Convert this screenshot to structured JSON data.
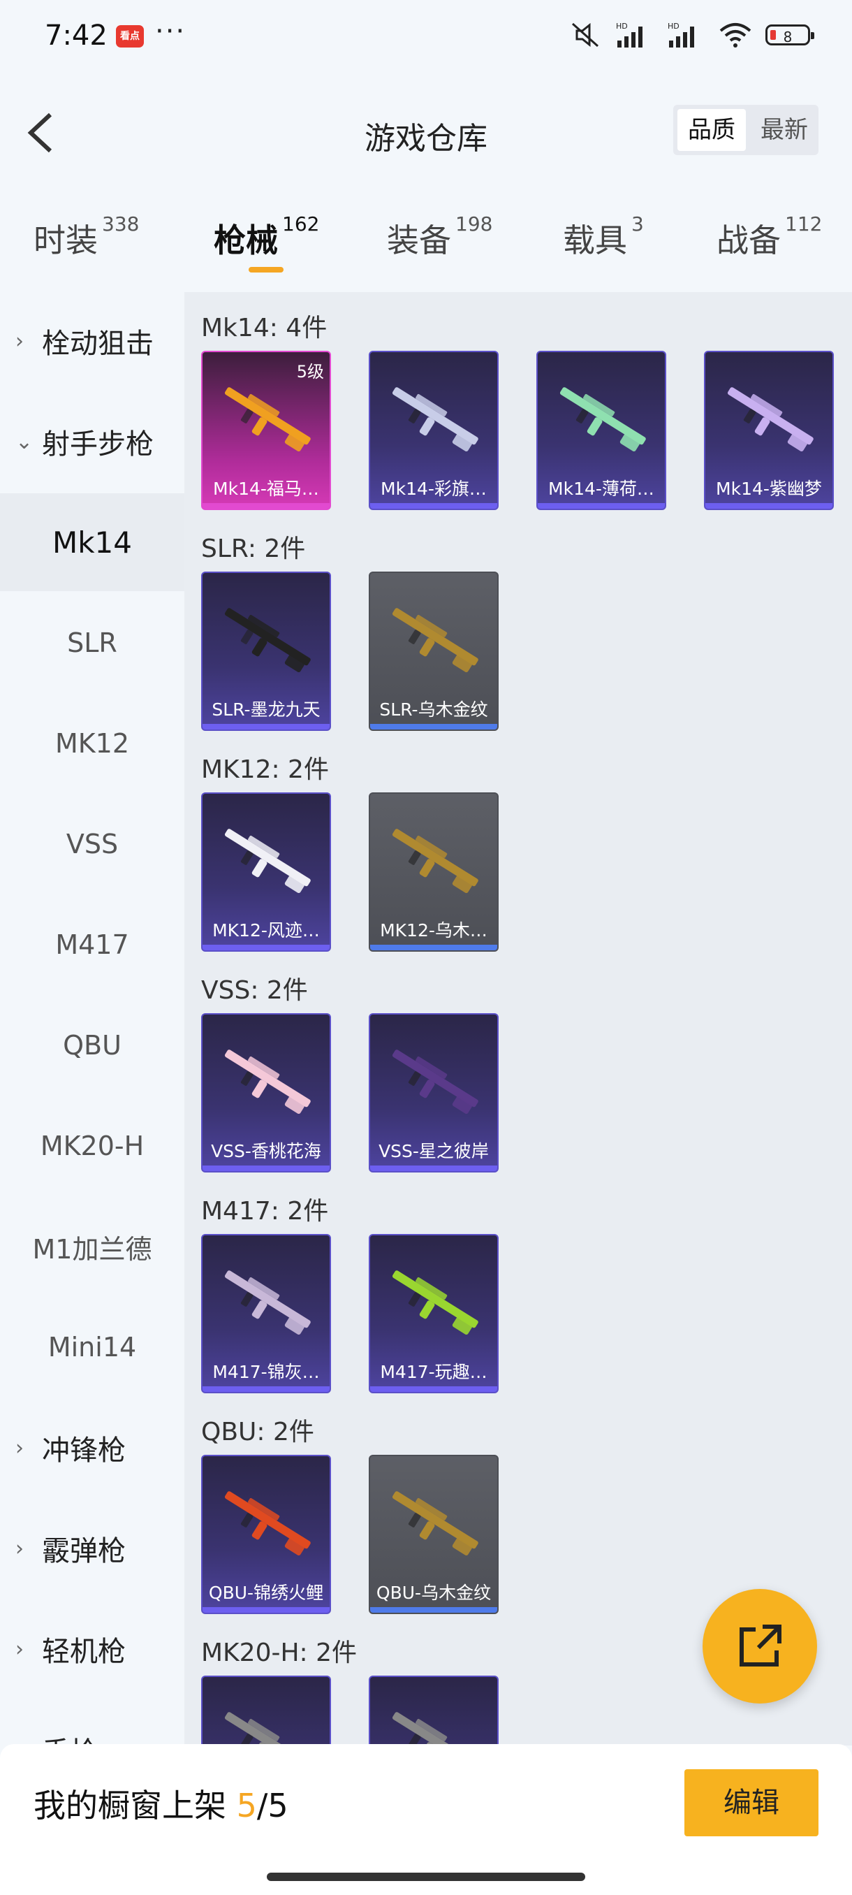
{
  "status": {
    "time": "7:42",
    "app_badge": "看点",
    "dots": "···",
    "signal1": "HD",
    "signal2": "HD",
    "battery": "8"
  },
  "header": {
    "title": "游戏仓库",
    "sort_quality": "品质",
    "sort_latest": "最新"
  },
  "tabs": [
    {
      "label": "时装",
      "count": "338"
    },
    {
      "label": "枪械",
      "count": "162"
    },
    {
      "label": "装备",
      "count": "198"
    },
    {
      "label": "载具",
      "count": "3"
    },
    {
      "label": "战备",
      "count": "112"
    }
  ],
  "sidebar": [
    {
      "label": "栓动狙击",
      "type": "category",
      "chevron": "›"
    },
    {
      "label": "射手步枪",
      "type": "category",
      "chevron": "⌄"
    },
    {
      "label": "Mk14",
      "type": "selected"
    },
    {
      "label": "SLR"
    },
    {
      "label": "MK12"
    },
    {
      "label": "VSS"
    },
    {
      "label": "M417"
    },
    {
      "label": "QBU"
    },
    {
      "label": "MK20-H"
    },
    {
      "label": "M1加兰德"
    },
    {
      "label": "Mini14"
    },
    {
      "label": "冲锋枪",
      "type": "category",
      "chevron": "›"
    },
    {
      "label": "霰弹枪",
      "type": "category",
      "chevron": "›"
    },
    {
      "label": "轻机枪",
      "type": "category",
      "chevron": "›"
    },
    {
      "label": "手枪",
      "type": "category",
      "chevron": "›"
    }
  ],
  "groups": [
    {
      "title": "Mk14: 4件",
      "items": [
        {
          "name": "Mk14-福马…",
          "style": "pink",
          "level": "5级",
          "color": "#f0a020"
        },
        {
          "name": "Mk14-彩旗…",
          "style": "purple",
          "color": "#c8cde8"
        },
        {
          "name": "Mk14-薄荷…",
          "style": "purple",
          "color": "#8fe0b0"
        },
        {
          "name": "Mk14-紫幽梦",
          "style": "purple",
          "color": "#c8b0f0"
        }
      ]
    },
    {
      "title": "SLR: 2件",
      "items": [
        {
          "name": "SLR-墨龙九天",
          "style": "purple",
          "color": "#222222"
        },
        {
          "name": "SLR-乌木金纹",
          "style": "gray",
          "color": "#b08a30"
        }
      ]
    },
    {
      "title": "MK12: 2件",
      "items": [
        {
          "name": "MK12-风迹…",
          "style": "purple",
          "color": "#f0f0f6"
        },
        {
          "name": "MK12-乌木…",
          "style": "gray",
          "color": "#b08a30"
        }
      ]
    },
    {
      "title": "VSS: 2件",
      "items": [
        {
          "name": "VSS-香桃花海",
          "style": "purple",
          "color": "#f4c8d8"
        },
        {
          "name": "VSS-星之彼岸",
          "style": "purple",
          "color": "#5a3a8a"
        }
      ]
    },
    {
      "title": "M417: 2件",
      "items": [
        {
          "name": "M417-锦灰…",
          "style": "purple",
          "color": "#c8b8d8"
        },
        {
          "name": "M417-玩趣…",
          "style": "purple",
          "color": "#9ad630"
        }
      ]
    },
    {
      "title": "QBU: 2件",
      "items": [
        {
          "name": "QBU-锦绣火鲤",
          "style": "purple",
          "color": "#e04a20"
        },
        {
          "name": "QBU-乌木金纹",
          "style": "gray",
          "color": "#b08a30"
        }
      ]
    },
    {
      "title": "MK20-H: 2件",
      "items": [
        {
          "name": "",
          "style": "purple",
          "color": "#888888"
        },
        {
          "name": "",
          "style": "purple",
          "color": "#888888"
        }
      ]
    }
  ],
  "bottom": {
    "prefix": "我的橱窗上架 ",
    "count": "5",
    "suffix": "/5",
    "edit": "编辑"
  },
  "colors": {
    "accent": "#f7b21f",
    "purple_bar": "#6d5ff0",
    "blue_bar": "#4f7bea"
  }
}
